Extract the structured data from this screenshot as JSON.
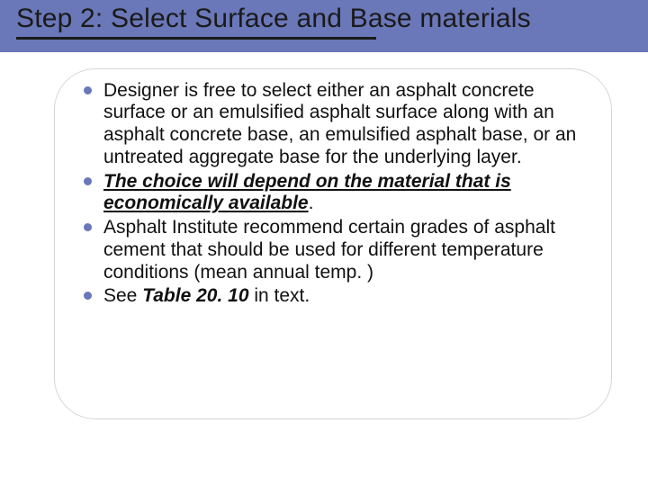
{
  "title": "Step 2: Select Surface and Base materials",
  "bullets": [
    {
      "type": "plain",
      "text": "Designer is free to select either  an asphalt concrete surface or an emulsified asphalt surface along with an asphalt concrete base, an emulsified asphalt base, or an untreated aggregate base for the underlying layer."
    },
    {
      "type": "emph",
      "text": "The choice will depend on the material that is economically available",
      "trail": "."
    },
    {
      "type": "plain",
      "text": "Asphalt Institute recommend certain grades of asphalt cement that should be used for different temperature conditions (mean annual temp. )"
    },
    {
      "type": "ref",
      "lead": "See ",
      "ref": "Table 20. 10",
      "trail": " in text."
    }
  ]
}
